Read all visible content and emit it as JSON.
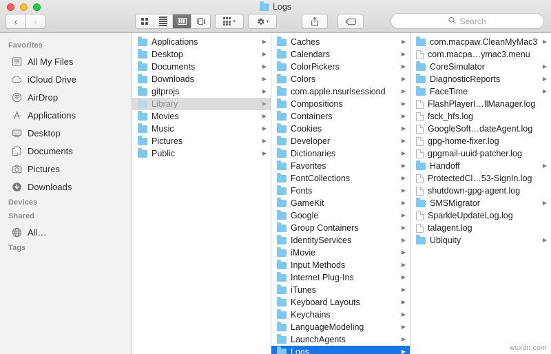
{
  "window": {
    "title": "Logs",
    "title_icon": "folder-icon",
    "traffic_lights": [
      {
        "name": "close-button",
        "color": "#ff5f57"
      },
      {
        "name": "minimize-button",
        "color": "#ffbd2e"
      },
      {
        "name": "maximize-button",
        "color": "#28c840"
      }
    ]
  },
  "toolbar": {
    "back_label": "‹",
    "forward_label": "›",
    "views": [
      {
        "name": "icon-view-button",
        "icon": "grid-icon",
        "active": false
      },
      {
        "name": "list-view-button",
        "icon": "list-icon",
        "active": false
      },
      {
        "name": "column-view-button",
        "icon": "columns-icon",
        "active": true
      },
      {
        "name": "gallery-view-button",
        "icon": "gallery-icon",
        "active": false
      }
    ],
    "arrange_icon": "arrange-grid-icon",
    "action_icon": "gear-icon",
    "share_icon": "share-icon",
    "tag_icon": "tag-icon",
    "chevron": "▾"
  },
  "search": {
    "icon": "search-icon",
    "placeholder": "Search",
    "value": ""
  },
  "sidebar": {
    "sections": [
      {
        "header": "Favorites",
        "items": [
          {
            "label": "All My Files",
            "icon": "all-my-files-icon"
          },
          {
            "label": "iCloud Drive",
            "icon": "cloud-icon"
          },
          {
            "label": "AirDrop",
            "icon": "airdrop-icon"
          },
          {
            "label": "Applications",
            "icon": "applications-icon"
          },
          {
            "label": "Desktop",
            "icon": "desktop-icon"
          },
          {
            "label": "Documents",
            "icon": "documents-icon"
          },
          {
            "label": "Pictures",
            "icon": "pictures-icon"
          },
          {
            "label": "Downloads",
            "icon": "downloads-icon"
          }
        ]
      },
      {
        "header": "Devices",
        "items": []
      },
      {
        "header": "Shared",
        "items": [
          {
            "label": "All…",
            "icon": "network-globe-icon"
          }
        ]
      },
      {
        "header": "Tags",
        "items": []
      }
    ]
  },
  "colors": {
    "selection_active": "#1a75e8",
    "selection_inactive": "#dcdcdc",
    "folder": "#7cc8ee",
    "titlebar_top": "#e9e9e9",
    "titlebar_bottom": "#d8d8d8",
    "sidebar_bg": "#f2f2f2"
  },
  "columns": [
    {
      "name": "column-home",
      "items": [
        {
          "label": "Applications",
          "type": "folder",
          "arrow": true,
          "selected": "none"
        },
        {
          "label": "Desktop",
          "type": "folder",
          "arrow": true,
          "selected": "none"
        },
        {
          "label": "Documents",
          "type": "folder",
          "arrow": true,
          "selected": "none"
        },
        {
          "label": "Downloads",
          "type": "folder",
          "arrow": true,
          "selected": "none"
        },
        {
          "label": "gitprojs",
          "type": "folder",
          "arrow": true,
          "selected": "none"
        },
        {
          "label": "Library",
          "type": "folder",
          "arrow": true,
          "selected": "inactive"
        },
        {
          "label": "Movies",
          "type": "folder",
          "arrow": true,
          "selected": "none"
        },
        {
          "label": "Music",
          "type": "folder",
          "arrow": true,
          "selected": "none"
        },
        {
          "label": "Pictures",
          "type": "folder",
          "arrow": true,
          "selected": "none"
        },
        {
          "label": "Public",
          "type": "folder",
          "arrow": true,
          "selected": "none"
        }
      ]
    },
    {
      "name": "column-library",
      "items": [
        {
          "label": "Caches",
          "type": "folder",
          "arrow": true,
          "selected": "none"
        },
        {
          "label": "Calendars",
          "type": "folder",
          "arrow": true,
          "selected": "none"
        },
        {
          "label": "ColorPickers",
          "type": "folder",
          "arrow": true,
          "selected": "none"
        },
        {
          "label": "Colors",
          "type": "folder",
          "arrow": true,
          "selected": "none"
        },
        {
          "label": "com.apple.nsurlsessiond",
          "type": "folder",
          "arrow": true,
          "selected": "none"
        },
        {
          "label": "Compositions",
          "type": "folder",
          "arrow": true,
          "selected": "none"
        },
        {
          "label": "Containers",
          "type": "folder",
          "arrow": true,
          "selected": "none"
        },
        {
          "label": "Cookies",
          "type": "folder",
          "arrow": true,
          "selected": "none"
        },
        {
          "label": "Developer",
          "type": "folder",
          "arrow": true,
          "selected": "none"
        },
        {
          "label": "Dictionaries",
          "type": "folder",
          "arrow": true,
          "selected": "none"
        },
        {
          "label": "Favorites",
          "type": "folder",
          "arrow": true,
          "selected": "none"
        },
        {
          "label": "FontCollections",
          "type": "folder",
          "arrow": true,
          "selected": "none"
        },
        {
          "label": "Fonts",
          "type": "folder",
          "arrow": true,
          "selected": "none"
        },
        {
          "label": "GameKit",
          "type": "folder",
          "arrow": true,
          "selected": "none"
        },
        {
          "label": "Google",
          "type": "folder",
          "arrow": true,
          "selected": "none"
        },
        {
          "label": "Group Containers",
          "type": "folder",
          "arrow": true,
          "selected": "none"
        },
        {
          "label": "IdentityServices",
          "type": "folder",
          "arrow": true,
          "selected": "none"
        },
        {
          "label": "iMovie",
          "type": "folder",
          "arrow": true,
          "selected": "none"
        },
        {
          "label": "Input Methods",
          "type": "folder",
          "arrow": true,
          "selected": "none"
        },
        {
          "label": "Internet Plug-Ins",
          "type": "folder",
          "arrow": true,
          "selected": "none"
        },
        {
          "label": "iTunes",
          "type": "folder",
          "arrow": true,
          "selected": "none"
        },
        {
          "label": "Keyboard Layouts",
          "type": "folder",
          "arrow": true,
          "selected": "none"
        },
        {
          "label": "Keychains",
          "type": "folder",
          "arrow": true,
          "selected": "none"
        },
        {
          "label": "LanguageModeling",
          "type": "folder",
          "arrow": true,
          "selected": "none"
        },
        {
          "label": "LaunchAgents",
          "type": "folder",
          "arrow": true,
          "selected": "none"
        },
        {
          "label": "Logs",
          "type": "folder",
          "arrow": true,
          "selected": "active"
        }
      ]
    },
    {
      "name": "column-logs",
      "items": [
        {
          "label": "com.macpaw.CleanMyMac3",
          "type": "folder",
          "arrow": true,
          "selected": "none"
        },
        {
          "label": "com.macpa…ymac3.menu",
          "type": "doc",
          "arrow": false,
          "selected": "none"
        },
        {
          "label": "CoreSimulator",
          "type": "folder",
          "arrow": true,
          "selected": "none"
        },
        {
          "label": "DiagnosticReports",
          "type": "folder",
          "arrow": true,
          "selected": "none"
        },
        {
          "label": "FaceTime",
          "type": "folder",
          "arrow": true,
          "selected": "none"
        },
        {
          "label": "FlashPlayerI…llManager.log",
          "type": "doc",
          "arrow": false,
          "selected": "none"
        },
        {
          "label": "fsck_hfs.log",
          "type": "doc",
          "arrow": false,
          "selected": "none"
        },
        {
          "label": "GoogleSoft…dateAgent.log",
          "type": "doc",
          "arrow": false,
          "selected": "none"
        },
        {
          "label": "gpg-home-fixer.log",
          "type": "doc",
          "arrow": false,
          "selected": "none"
        },
        {
          "label": "gpgmail-uuid-patcher.log",
          "type": "doc",
          "arrow": false,
          "selected": "none"
        },
        {
          "label": "Handoff",
          "type": "folder",
          "arrow": true,
          "selected": "none"
        },
        {
          "label": "ProtectedCl…53-SignIn.log",
          "type": "doc",
          "arrow": false,
          "selected": "none"
        },
        {
          "label": "shutdown-gpg-agent.log",
          "type": "doc",
          "arrow": false,
          "selected": "none"
        },
        {
          "label": "SMSMigrator",
          "type": "folder",
          "arrow": true,
          "selected": "none"
        },
        {
          "label": "SparkleUpdateLog.log",
          "type": "doc",
          "arrow": false,
          "selected": "none"
        },
        {
          "label": "talagent.log",
          "type": "doc",
          "arrow": false,
          "selected": "none"
        },
        {
          "label": "Ubiquity",
          "type": "folder",
          "arrow": true,
          "selected": "none"
        }
      ]
    }
  ],
  "watermark": "wsxdn.com"
}
